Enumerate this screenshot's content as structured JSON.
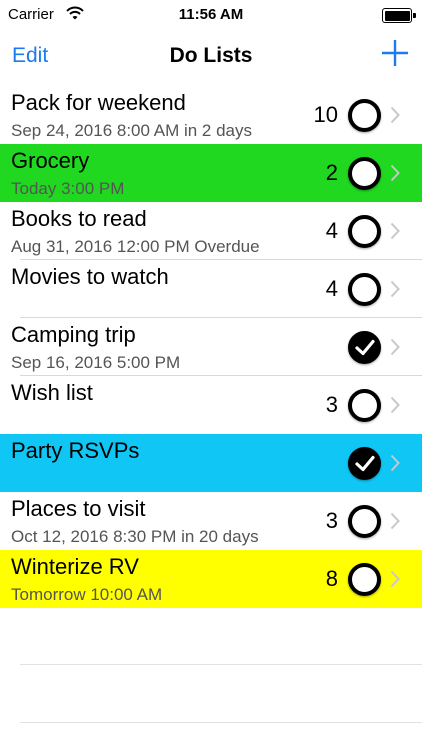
{
  "status_bar": {
    "carrier": "Carrier",
    "time": "11:56 AM",
    "icons": [
      "wifi-icon",
      "battery-icon"
    ]
  },
  "nav": {
    "edit_label": "Edit",
    "title": "Do Lists",
    "add_icon": "plus-icon",
    "accent_color": "#1a7cf0"
  },
  "lists": [
    {
      "title": "Pack for weekend",
      "subtitle": "Sep 24, 2016 8:00 AM  in 2 days",
      "count": "10",
      "done": false,
      "color": "#ffffff"
    },
    {
      "title": "Grocery",
      "subtitle": "Today 3:00 PM",
      "count": "2",
      "done": false,
      "color": "#1fd81f"
    },
    {
      "title": "Books to read",
      "subtitle": "Aug 31, 2016 12:00 PM  Overdue",
      "count": "4",
      "done": false,
      "color": "#ffffff"
    },
    {
      "title": "Movies to watch",
      "subtitle": "",
      "count": "4",
      "done": false,
      "color": "#ffffff"
    },
    {
      "title": "Camping trip",
      "subtitle": "Sep 16, 2016 5:00 PM",
      "count": "",
      "done": true,
      "color": "#ffffff"
    },
    {
      "title": "Wish list",
      "subtitle": "",
      "count": "3",
      "done": false,
      "color": "#ffffff"
    },
    {
      "title": "Party RSVPs",
      "subtitle": "",
      "count": "",
      "done": true,
      "color": "#0fc6f5"
    },
    {
      "title": "Places to visit",
      "subtitle": "Oct 12, 2016 8:30 PM  in 20 days",
      "count": "3",
      "done": false,
      "color": "#ffffff"
    },
    {
      "title": "Winterize RV",
      "subtitle": "Tomorrow 10:00 AM",
      "count": "8",
      "done": false,
      "color": "#ffff00"
    }
  ]
}
